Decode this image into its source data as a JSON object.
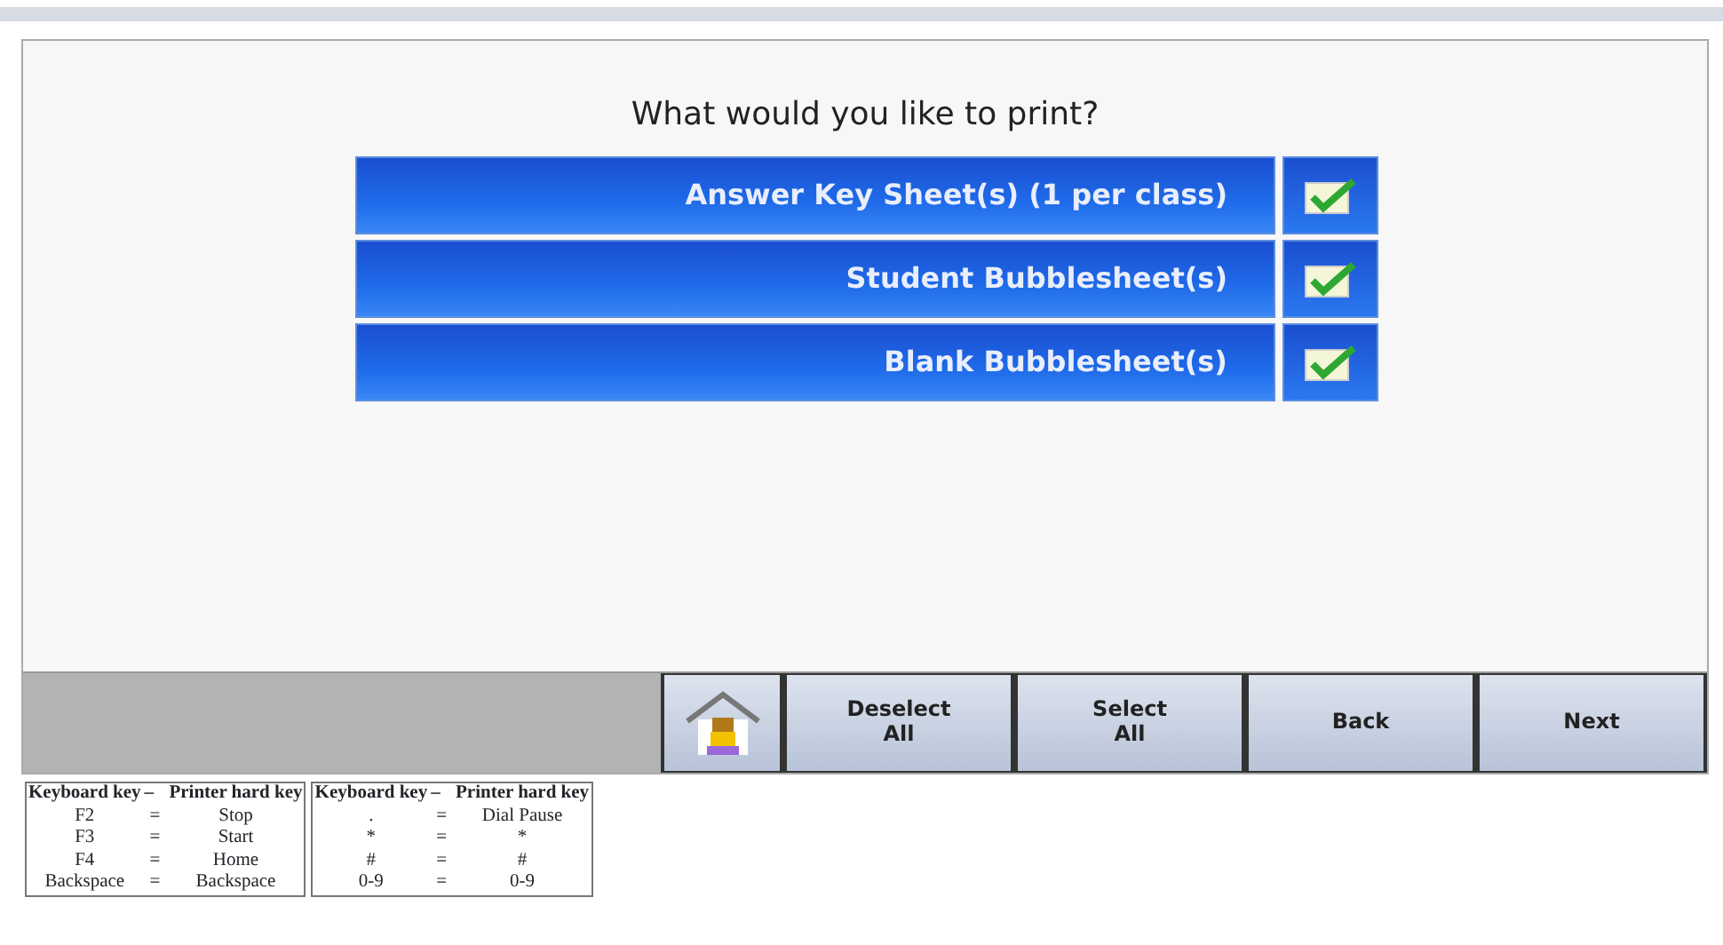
{
  "prompt": "What would you like to print?",
  "options": [
    {
      "label": "Answer Key Sheet(s) (1 per class)",
      "checked": true
    },
    {
      "label": "Student Bubblesheet(s)",
      "checked": true
    },
    {
      "label": "Blank Bubblesheet(s)",
      "checked": true
    }
  ],
  "toolbar": [
    {
      "kind": "home"
    },
    {
      "kind": "text",
      "label": "Deselect\nAll"
    },
    {
      "kind": "text",
      "label": "Select\nAll"
    },
    {
      "kind": "text",
      "label": "Back"
    },
    {
      "kind": "text",
      "label": "Next"
    }
  ],
  "key_tables": [
    {
      "header": [
        "Keyboard key",
        "–",
        "Printer hard key"
      ],
      "rows": [
        [
          "F2",
          "=",
          "Stop"
        ],
        [
          "F3",
          "=",
          "Start"
        ],
        [
          "F4",
          "=",
          "Home"
        ],
        [
          "Backspace",
          "=",
          "Backspace"
        ]
      ]
    },
    {
      "header": [
        "Keyboard key",
        "–",
        "Printer hard key"
      ],
      "rows": [
        [
          ".",
          "=",
          "Dial Pause"
        ],
        [
          "*",
          "=",
          "*"
        ],
        [
          "#",
          "=",
          "#"
        ],
        [
          "0-9",
          "=",
          "0-9"
        ]
      ]
    }
  ]
}
